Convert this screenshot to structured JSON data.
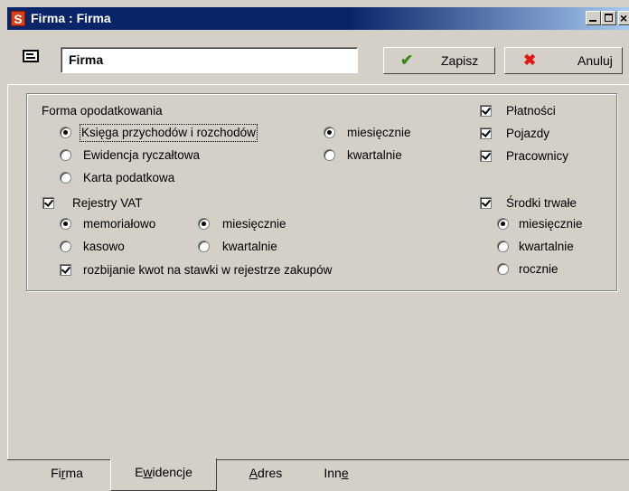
{
  "window": {
    "app_icon_letter": "S",
    "title": "Firma : Firma",
    "controls": {
      "minimize": "_",
      "maximize": "□",
      "close": "×"
    }
  },
  "toolbar": {
    "name_value": "Firma",
    "save_label": "Zapisz",
    "save_icon": "green-checkmark-icon",
    "cancel_label": "Anuluj",
    "cancel_icon": "red-x-icon"
  },
  "tax_form": {
    "heading": "Forma opodatkowania",
    "options": [
      {
        "label": "Księga przychodów i rozchodów",
        "selected": true
      },
      {
        "label": "Ewidencja ryczałtowa",
        "selected": false
      },
      {
        "label": "Karta podatkowa",
        "selected": false
      }
    ],
    "period": [
      {
        "label": "miesięcznie",
        "selected": true
      },
      {
        "label": "kwartalnie",
        "selected": false
      }
    ]
  },
  "right_checks": [
    {
      "label": "Płatności",
      "checked": true
    },
    {
      "label": "Pojazdy",
      "checked": true
    },
    {
      "label": "Pracownicy",
      "checked": true
    }
  ],
  "vat": {
    "label": "Rejestry VAT",
    "checked": true,
    "method": [
      {
        "label": "memoriałowo",
        "selected": true
      },
      {
        "label": "kasowo",
        "selected": false
      }
    ],
    "period": [
      {
        "label": "miesięcznie",
        "selected": true
      },
      {
        "label": "kwartalnie",
        "selected": false
      }
    ],
    "split_label": "rozbijanie kwot na stawki w rejestrze zakupów",
    "split_checked": true
  },
  "fixed_assets": {
    "label": "Środki trwałe",
    "checked": true,
    "period": [
      {
        "label": "miesięcznie",
        "selected": true
      },
      {
        "label": "kwartalnie",
        "selected": false
      },
      {
        "label": "rocznie",
        "selected": false
      }
    ]
  },
  "tabs": {
    "t1_pre": "Fi",
    "t1_u": "r",
    "t1_post": "ma",
    "t2_pre": "E",
    "t2_u": "w",
    "t2_post": "idencje",
    "t3_pre": "",
    "t3_u": "A",
    "t3_post": "dres",
    "t4_pre": "Inn",
    "t4_u": "e",
    "t4_post": "",
    "active": "Ewidencje"
  }
}
